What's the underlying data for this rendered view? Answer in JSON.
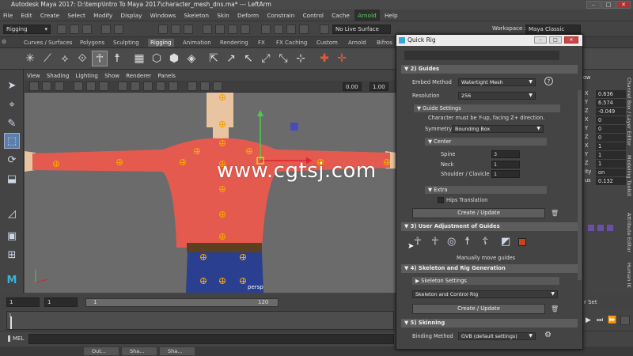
{
  "window": {
    "title": "Autodesk Maya 2017: D:\\temp\\Intro To Maya 2017\\character_mesh_dns.ma*   ---   LeftArm"
  },
  "menu": [
    "File",
    "Edit",
    "Create",
    "Select",
    "Modify",
    "Display",
    "Windows",
    "Skeleton",
    "Skin",
    "Deform",
    "Constrain",
    "Control",
    "Cache",
    "Arnold",
    "Help"
  ],
  "status": {
    "mode": "Rigging",
    "live_surface": "No Live Surface",
    "workspace_label": "Workspace :",
    "workspace": "Maya Classic"
  },
  "shelf_tabs": [
    "Curves / Surfaces",
    "Polygons",
    "Sculpting",
    "Rigging",
    "Animation",
    "Rendering",
    "FX",
    "FX Caching",
    "Custom",
    "Arnold",
    "Bifros"
  ],
  "viewport": {
    "menu": [
      "View",
      "Shading",
      "Lighting",
      "Show",
      "Renderer",
      "Panels"
    ],
    "field1": "0.00",
    "field2": "1.00",
    "camera": "persp"
  },
  "watermark": "www.cgtsj.com",
  "quick_rig": {
    "title": "Quick Rig",
    "sections": {
      "guides": "2) Guides",
      "user_adjust": "3) User Adjustment of Guides",
      "skeleton_gen": "4) Skeleton and Rig Generation",
      "skinning": "5) Skinning"
    },
    "embed_method_label": "Embed Method",
    "embed_method": "Watertight Mesh",
    "resolution_label": "Resolution",
    "resolution": "256",
    "guide_settings": "Guide Settings",
    "guide_note": "Character must be Y-up, facing Z+ direction.",
    "symmetry_label": "Symmetry",
    "symmetry": "Bounding Box",
    "center": "Center",
    "spine_label": "Spine",
    "spine": "3",
    "neck_label": "Neck",
    "neck": "1",
    "shoulder_label": "Shoulder / Clavicle",
    "shoulder": "1",
    "extra": "Extra",
    "hips_translation": "Hips Translation",
    "create_update": "Create / Update",
    "manually_move": "Manually move guides",
    "skeleton_settings": "Skeleton Settings",
    "skeleton_type": "Skeleton and Control Rig",
    "create_update2": "Create / Update",
    "binding_label": "Binding Method",
    "binding": "GVB (default settings)"
  },
  "channel_box": {
    "labels": [
      "X",
      "Y",
      "Z",
      "X",
      "Y",
      "Z",
      "X",
      "Y",
      "Z",
      "ity",
      "us"
    ],
    "values": [
      "0.636",
      "6.574",
      "-0.049",
      "0",
      "0",
      "0",
      "1",
      "1",
      "1",
      "on",
      "0.132"
    ],
    "vtabs": [
      "Channel Box / Layer Editor",
      "Modeling Toolkit",
      "Attribute Editor",
      "Human IK"
    ],
    "top_word": "ow"
  },
  "timeline": {
    "start": "1",
    "inner_start": "1",
    "inner_end": "120",
    "range_start": "1",
    "tick_label": "1",
    "set_label": "r Set"
  },
  "mel": {
    "label": "MEL"
  },
  "taskbar": [
    "Out...",
    "Sha...",
    "Sha..."
  ],
  "colors": {
    "accent_orange": "#f4a300",
    "shirt": "#e55a4f",
    "pants": "#2a3f8f",
    "viewport_bg": "#6b6b6b"
  }
}
